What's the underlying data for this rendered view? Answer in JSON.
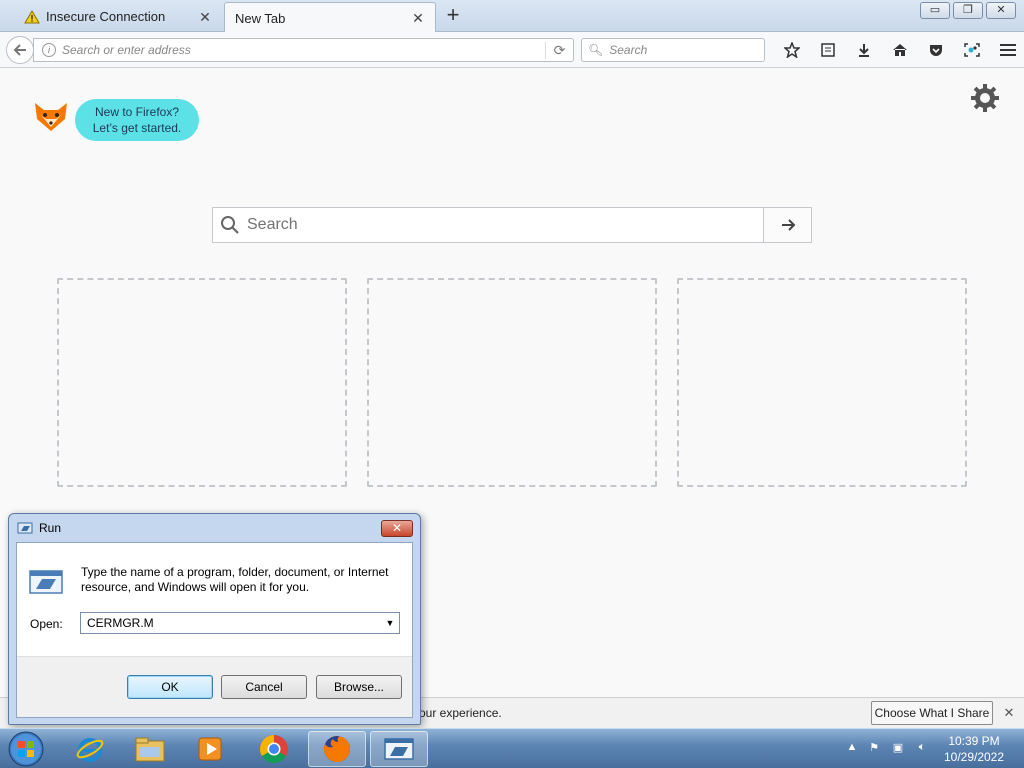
{
  "tabs": [
    {
      "label": "Insecure Connection",
      "icon": "warning-icon",
      "active": false
    },
    {
      "label": "New Tab",
      "icon": "",
      "active": true
    }
  ],
  "window_controls": {
    "minimize": "minimize-icon",
    "restore": "restore-icon",
    "close": "close-icon"
  },
  "navbar": {
    "url_placeholder": "Search or enter address",
    "search_placeholder": "Search",
    "toolbar_icons": [
      "bookmark-star-icon",
      "reading-list-icon",
      "downloads-icon",
      "home-icon",
      "pocket-icon",
      "screenshot-icon",
      "menu-icon"
    ]
  },
  "content": {
    "onboarding_line1": "New to Firefox?",
    "onboarding_line2": "Let’s get started.",
    "search_placeholder": "Search",
    "tile_count": 3
  },
  "notification": {
    "message": "our experience.",
    "button_label": "Choose What I Share"
  },
  "run_dialog": {
    "title": "Run",
    "description": "Type the name of a program, folder, document, or Internet resource, and Windows will open it for you.",
    "open_label": "Open:",
    "open_value": "CERMGR.M",
    "ok_label": "OK",
    "cancel_label": "Cancel",
    "browse_label": "Browse..."
  },
  "taskbar": {
    "items": [
      "internet-explorer-icon",
      "file-explorer-icon",
      "media-player-icon",
      "chrome-icon",
      "firefox-icon",
      "run-dialog-icon"
    ],
    "active_items": [
      "firefox-icon",
      "run-dialog-icon"
    ],
    "time": "10:39 PM",
    "date": "10/29/2022"
  },
  "colors": {
    "bubble": "#5ce1e6",
    "tab_strip": "#c9d8ea",
    "taskbar": "#5e86b5"
  }
}
